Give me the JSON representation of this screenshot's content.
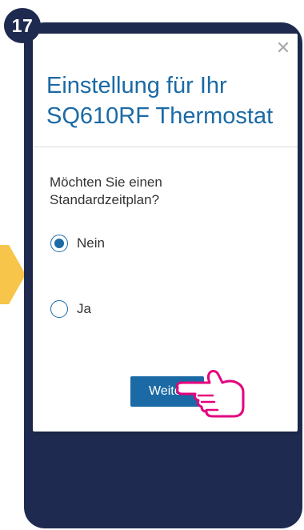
{
  "step_number": "17",
  "dialog": {
    "title": "Einstellung für Ihr SQ610RF Thermostat",
    "close_icon": "close-icon",
    "question": "Möchten Sie einen Standardzeitplan?",
    "options": [
      {
        "label": "Nein",
        "selected": true
      },
      {
        "label": "Ja",
        "selected": false
      }
    ],
    "next_button": "Weiter"
  },
  "colors": {
    "primary": "#1b6aa5",
    "phone_frame": "#1e2a4f",
    "accent_arrow": "#f8c54b",
    "pointer_hand": "#e5007e"
  }
}
